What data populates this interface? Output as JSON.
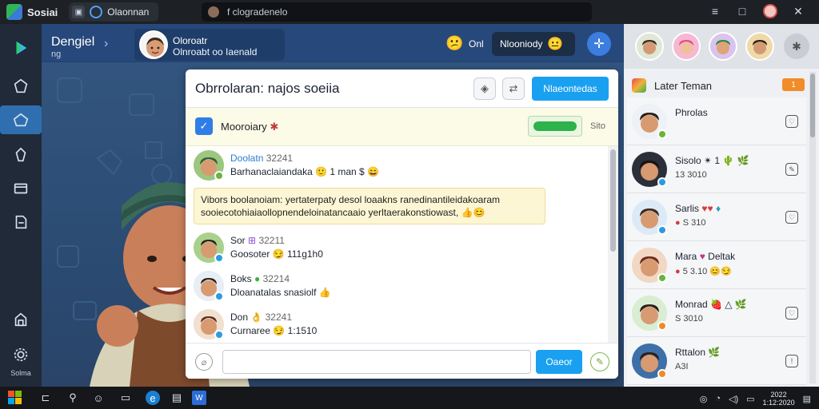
{
  "titlebar": {
    "app_name": "Sosiai",
    "tab1_label": "Olaonnan",
    "tab2_label": "f clogradenelo",
    "icons": [
      "minimize-icon",
      "maximize-icon",
      "avatar-icon"
    ]
  },
  "leftbar": {
    "bottom_label": "Solma"
  },
  "header": {
    "title": "Dengiel",
    "subtitle": "ng",
    "profile_name1": "Oloroatr",
    "profile_name2": "Olnroabt",
    "profile_name_extra": "oo Iaenald",
    "status": "Onl",
    "pill_label": "Nlooniody"
  },
  "chat": {
    "title": "Obrrolaran: najos soeiia",
    "action_button": "Nlaeontedas",
    "notice_text": "Mooroiary",
    "notice_button": "",
    "notice_meta": "Sito",
    "highlight_line1": "Vibors boolanoiam: yertaterpaty desol loaakns ranedinantileidakoaram",
    "highlight_line2": "sooiecotohiaiaollopnendeloinatancaaio yerltaerakonstiowast,",
    "messages": [
      {
        "name": "Doolatn",
        "time": "32241",
        "text": "Barhanaclaiandaka",
        "meta": "1 man"
      },
      {
        "name": "Sor",
        "time": "32211",
        "text": "Goosoter",
        "meta": "111g1h0"
      },
      {
        "name": "Boks",
        "time": "32214",
        "text": "Dloanatalas snasiolf"
      },
      {
        "name": "Don",
        "time": "32241",
        "text": "Curnaree",
        "meta": "1:1510"
      }
    ],
    "input_placeholder": "",
    "send_label": "Oaeor"
  },
  "rightpanel": {
    "header": "Later Teman",
    "header_badge": "1",
    "contacts": [
      {
        "name": "Phrolas",
        "sub": ""
      },
      {
        "name": "Sisolo",
        "sub": "13 3010"
      },
      {
        "name": "Sarlis",
        "sub": "S 310"
      },
      {
        "name": "Mara",
        "sub": "5 3.10",
        "extra": "Deltak"
      },
      {
        "name": "Monrad",
        "sub": "S 3010"
      },
      {
        "name": "Rttalon",
        "sub": "A3I"
      }
    ]
  },
  "taskbar": {
    "clock_time": "2022",
    "clock_date": "1:12:2020"
  },
  "colors": {
    "accent": "#1aa0f0",
    "header_bg": "#27487a",
    "sidebar_active": "#2f6fb0"
  }
}
